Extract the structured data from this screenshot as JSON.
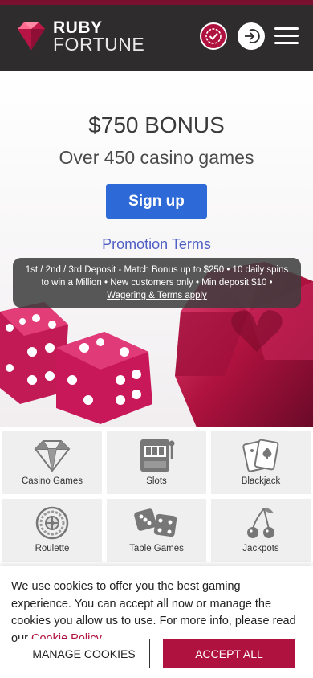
{
  "colors": {
    "header_bg": "#2f2c2e",
    "brand_ruby": "#b0123f",
    "signup_blue": "#2d6ad7",
    "promo_link": "#4f5fc4"
  },
  "header": {
    "logo_line1": "RUBY",
    "logo_line2": "FORTUNE",
    "logo_icon": "ruby-gem-icon",
    "check_icon": "check-badge-icon",
    "login_icon": "login-arrow-icon",
    "menu_icon": "hamburger-icon"
  },
  "hero": {
    "bonus_title": "$750 BONUS",
    "bonus_subtitle": "Over 450 casino games",
    "signup_label": "Sign up",
    "promo_terms_label": "Promotion Terms",
    "terms_text": "1st / 2nd / 3rd Deposit - Match Bonus up to $250 • 10 daily spins to win a Million • New customers only • Min deposit $10 •",
    "terms_link": "Wagering & Terms apply"
  },
  "categories": [
    {
      "label": "Casino Games",
      "icon": "diamond-icon"
    },
    {
      "label": "Slots",
      "icon": "slot-machine-icon"
    },
    {
      "label": "Blackjack",
      "icon": "playing-cards-icon"
    },
    {
      "label": "Roulette",
      "icon": "roulette-wheel-icon"
    },
    {
      "label": "Table Games",
      "icon": "dice-icon"
    },
    {
      "label": "Jackpots",
      "icon": "cherries-icon"
    }
  ],
  "cookie": {
    "text": "We use cookies to offer you the best gaming experience. You can accept all now or manage the cookies you allow us to use. For more info, please read our ",
    "link": "Cookie Policy",
    "manage_label": "MANAGE COOKIES",
    "accept_label": "ACCEPT ALL"
  }
}
